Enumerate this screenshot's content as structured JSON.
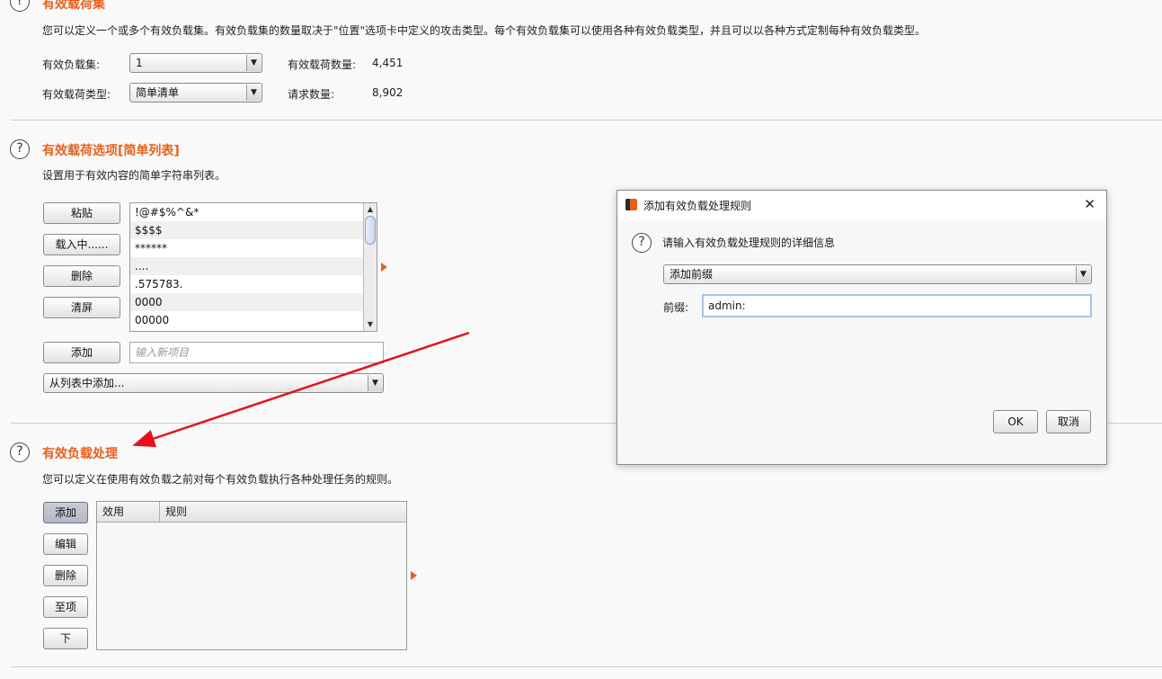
{
  "payload_sets": {
    "title": "有效载荷集",
    "description": "您可以定义一个或多个有效负载集。有效负载集的数量取决于\"位置\"选项卡中定义的攻击类型。每个有效负载集可以使用各种有效负载类型，并且可以以各种方式定制每种有效负载类型。",
    "set_label": "有效负载集:",
    "set_value": "1",
    "count_label": "有效载荷数量:",
    "count_value": "4,451",
    "type_label": "有效载荷类型:",
    "type_value": "简单清单",
    "requests_label": "请求数量:",
    "requests_value": "8,902"
  },
  "payload_options": {
    "title": "有效载荷选项[简单列表]",
    "description": "设置用于有效内容的简单字符串列表。",
    "buttons": {
      "paste": "粘贴",
      "load": "载入中......",
      "remove": "删除",
      "clear": "清屏",
      "add": "添加"
    },
    "items": [
      "!@#$%^&*",
      "$$$$",
      "******",
      "....",
      ".575783.",
      "0000",
      "00000"
    ],
    "new_item_placeholder": "输入新项目",
    "add_from_list": "从列表中添加..."
  },
  "payload_processing": {
    "title": "有效负载处理",
    "description": "您可以定义在使用有效负载之前对每个有效负载执行各种处理任务的规则。",
    "buttons": {
      "add": "添加",
      "edit": "编辑",
      "remove": "删除",
      "up": "至项",
      "down": "下"
    },
    "columns": [
      "效用",
      "规则"
    ]
  },
  "dialog": {
    "title": "添加有效负载处理规则",
    "close_glyph": "✕",
    "prompt": "请输入有效负载处理规则的详细信息",
    "rule_type": "添加前缀",
    "prefix_label": "前缀:",
    "prefix_value": "admin:",
    "ok": "OK",
    "cancel": "取消"
  },
  "icons": {
    "help": "?",
    "dropdown": "▼",
    "scroll_up": "▲",
    "scroll_down": "▼"
  },
  "colors": {
    "accent": "#e8601c",
    "annotation_arrow": "#e8101c"
  }
}
